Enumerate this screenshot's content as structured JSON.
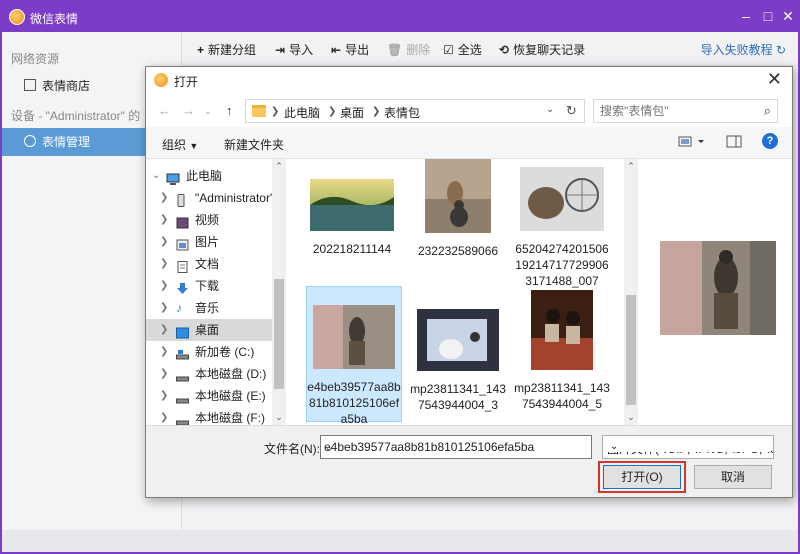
{
  "app": {
    "title": "微信表情",
    "window_controls": {
      "minimize": "–",
      "maximize": "□",
      "close": "✕"
    }
  },
  "sidebar": {
    "network_heading": "网络资源",
    "store_label": "表情商店",
    "device_heading": "设备 - \"Administrator\" 的",
    "manage_label": "表情管理"
  },
  "toolbar": {
    "new_group": "新建分组",
    "import": "导入",
    "export": "导出",
    "delete": "删除",
    "select_all": "全选",
    "restore": "恢复聊天记录",
    "help_link": "导入失败教程"
  },
  "dialog": {
    "title": "打开",
    "breadcrumb": [
      "此电脑",
      "桌面",
      "表情包"
    ],
    "search_placeholder": "搜索\"表情包\"",
    "organize": "组织",
    "new_folder": "新建文件夹",
    "tree": [
      {
        "label": "此电脑",
        "icon": "computer-icon"
      },
      {
        "label": "\"Administrator\"",
        "icon": "phone-icon"
      },
      {
        "label": "视频",
        "icon": "video-folder-icon"
      },
      {
        "label": "图片",
        "icon": "pictures-folder-icon"
      },
      {
        "label": "文档",
        "icon": "documents-folder-icon"
      },
      {
        "label": "下载",
        "icon": "download-icon"
      },
      {
        "label": "音乐",
        "icon": "music-icon"
      },
      {
        "label": "桌面",
        "icon": "desktop-folder-icon"
      },
      {
        "label": "新加卷 (C:)",
        "icon": "drive-icon"
      },
      {
        "label": "本地磁盘 (D:)",
        "icon": "drive-icon"
      },
      {
        "label": "本地磁盘 (E:)",
        "icon": "drive-icon"
      },
      {
        "label": "本地磁盘 (F:)",
        "icon": "drive-icon"
      }
    ],
    "files": [
      {
        "name": "202218211144"
      },
      {
        "name": "232232589066"
      },
      {
        "name": "65204274201506192147177299063171488_007"
      },
      {
        "name": "e4beb39577aa8b81b810125106efa5ba"
      },
      {
        "name": "mp23811341_1437543944004_3"
      },
      {
        "name": "mp23811341_1437543944004_5"
      }
    ],
    "filename_label": "文件名(N):",
    "filename_value": "e4beb39577aa8b81b810125106efa5ba",
    "filetype": "图片文件(*.GIF;*.PNG;*.JPG;*.J",
    "open_button": "打开(O)",
    "cancel_button": "取消"
  },
  "colors": {
    "title_bar": "#7c3cc8",
    "sidebar_active": "#5b9bd5",
    "highlight": "#d9342b"
  }
}
